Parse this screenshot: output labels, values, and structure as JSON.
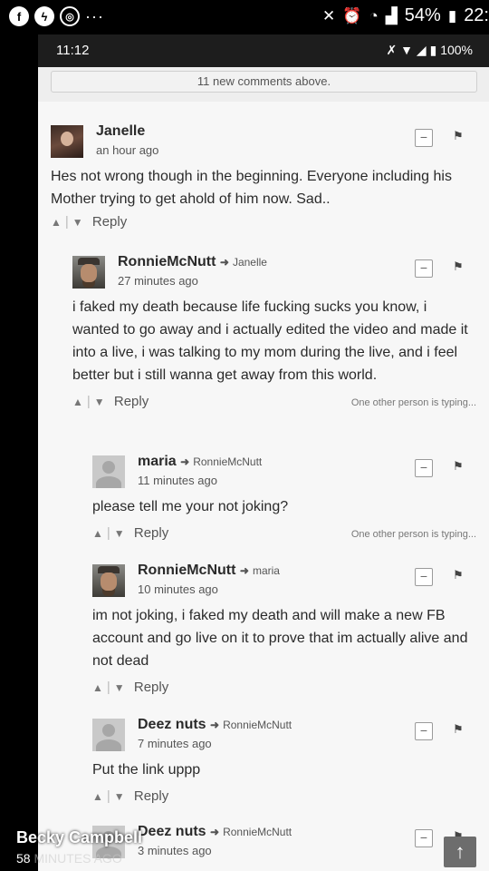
{
  "outer_status": {
    "icons": [
      "facebook-messenger-icon",
      "messenger-icon",
      "instagram-icon"
    ],
    "more": "···",
    "battery": "54%",
    "time": "22:"
  },
  "inner_status": {
    "time": "11:12",
    "battery": "100%"
  },
  "banner": {
    "text": "11 new comments above."
  },
  "comments": [
    {
      "author": "Janelle",
      "reply_to": "",
      "time": "an hour ago",
      "body": "Hes not wrong though in the beginning. Everyone including his Mother trying to get ahold of him now. Sad..",
      "reply_label": "Reply",
      "typing": ""
    },
    {
      "author": "RonnieMcNutt",
      "reply_to": "Janelle",
      "time": "27 minutes ago",
      "body": "i faked my death because life fucking sucks you know, i wanted to go away and i actually edited the video and made it into a live, i was talking to my mom during the live, and i feel better but i still wanna get away from this world.",
      "reply_label": "Reply",
      "typing": "One other person is typing..."
    },
    {
      "author": "maria",
      "reply_to": "RonnieMcNutt",
      "time": "11 minutes ago",
      "body": "please tell me your not joking?",
      "reply_label": "Reply",
      "typing": "One other person is typing..."
    },
    {
      "author": "RonnieMcNutt",
      "reply_to": "maria",
      "time": "10 minutes ago",
      "body": "im not joking, i faked my death and will make a new FB account and go live on it to prove that im actually alive and not dead",
      "reply_label": "Reply",
      "typing": ""
    },
    {
      "author": "Deez nuts",
      "reply_to": "RonnieMcNutt",
      "time": "7 minutes ago",
      "body": "Put the link uppp",
      "reply_label": "Reply",
      "typing": ""
    },
    {
      "author": "Deez nuts",
      "reply_to": "RonnieMcNutt",
      "time": "3 minutes ago",
      "body": "",
      "reply_label": "",
      "typing": ""
    }
  ],
  "overlay": {
    "name": "Becky Campbell",
    "count": "58",
    "time_label": "MINUTES AGO"
  }
}
